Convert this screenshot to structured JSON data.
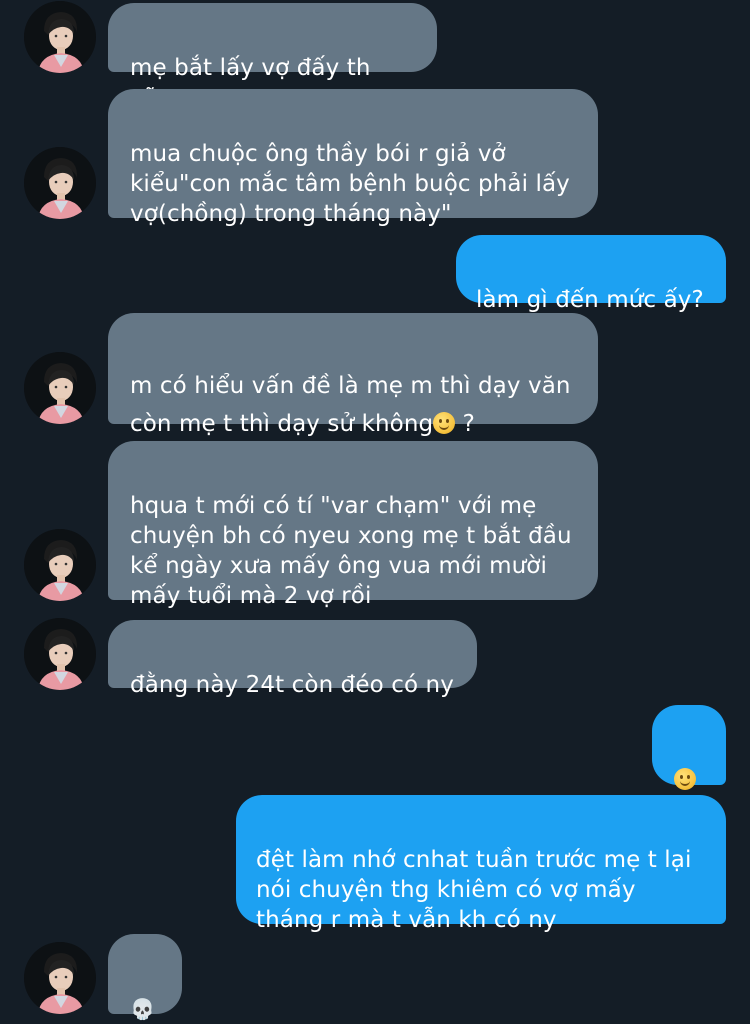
{
  "colors": {
    "background": "#141d26",
    "incoming_bubble": "#657786",
    "outgoing_bubble": "#1da1f2",
    "text": "#ffffff"
  },
  "messages": [
    {
      "direction": "incoming",
      "text": "mẹ bắt lấy vợ đấy th cũy"
    },
    {
      "direction": "incoming",
      "text": "mua chuộc ông thầy bói r giả vở\nkiểu\"con mắc tâm bệnh buộc phải lấy\nvợ(chồng) trong tháng này\""
    },
    {
      "direction": "outgoing",
      "text": "làm gì đến mức ấy?"
    },
    {
      "direction": "incoming",
      "text": "m có hiểu vấn đề là mẹ m thì dạy văn\ncòn mẹ t thì dạy sử không",
      "trailing_emoji": "slightly-smiling-face",
      "suffix": " ?"
    },
    {
      "direction": "incoming",
      "text": "hqua t mới có tí \"var chạm\" với mẹ\nchuyện bh có nyeu xong mẹ t bắt đầu\nkể ngày xưa mấy ông vua mới mười\nmấy tuổi mà 2 vợ rồi"
    },
    {
      "direction": "incoming",
      "text": "đằng này 24t còn đéo có ny"
    },
    {
      "direction": "outgoing",
      "emoji": "slightly-smiling-face"
    },
    {
      "direction": "outgoing",
      "text": "đệt làm nhớ cnhat tuần trước mẹ t lại\nnói chuyện thg khiêm có vợ mấy\ntháng r mà t vẫn kh có ny"
    },
    {
      "direction": "incoming",
      "emoji": "skull",
      "emoji_glyph": "💀"
    }
  ]
}
